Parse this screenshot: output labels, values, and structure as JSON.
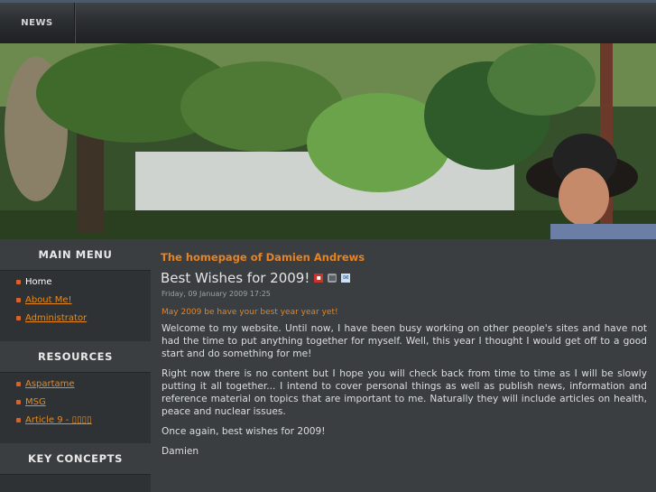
{
  "topnav": {
    "items": [
      {
        "label": "NEWS"
      }
    ]
  },
  "banner": {
    "description_icon": "photo-banner"
  },
  "sidebar": {
    "main_menu": {
      "title": "MAIN MENU",
      "items": [
        {
          "label": "Home",
          "active": true
        },
        {
          "label": "About Me!"
        },
        {
          "label": "Administrator"
        }
      ]
    },
    "resources": {
      "title": "RESOURCES",
      "items": [
        {
          "label": "Aspartame"
        },
        {
          "label": "MSG"
        },
        {
          "label": "Article 9 - ▯▯▯▯"
        }
      ]
    },
    "key_concepts": {
      "title": "KEY CONCEPTS"
    }
  },
  "main": {
    "site_title": "The homepage of Damien Andrews",
    "article": {
      "title": "Best Wishes for 2009!",
      "date": "Friday, 09 January 2009 17:25",
      "intro": "May 2009 be have your best year year yet!",
      "paragraphs": [
        "Welcome to my website. Until now, I have been busy working on other people's sites and have not had the time to put anything together for myself. Well, this year I thought I would get off to a good start and do something for me!",
        "Right now there is no content but I hope you will check back from time to time as I will be slowly putting it all together... I intend to cover personal things as well as publish news, information and reference material on topics that are important to me. Naturally they will include articles on health, peace and nuclear issues.",
        "Once again, best wishes for 2009!",
        "Damien"
      ]
    }
  },
  "colors": {
    "accent": "#e8831f",
    "bullet": "#d6632b",
    "background": "#2b2e30",
    "content_bg": "#3a3e41"
  }
}
